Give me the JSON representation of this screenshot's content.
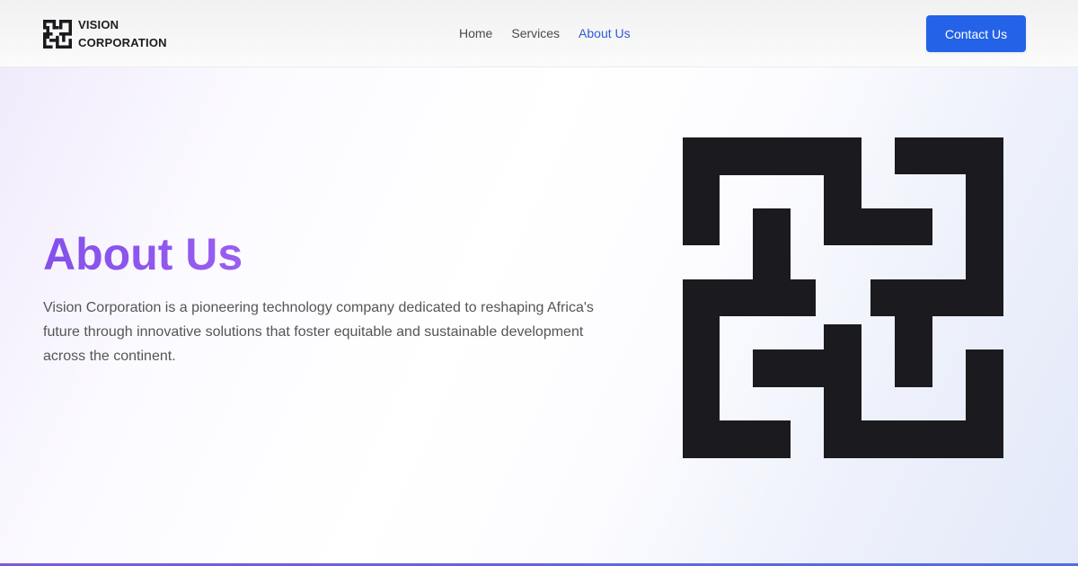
{
  "brand": {
    "name_line1": "VISION",
    "name_line2": "CORPORATION",
    "logo_icon": "maze-logo-icon"
  },
  "nav": {
    "items": [
      {
        "label": "Home",
        "active": false
      },
      {
        "label": "Services",
        "active": false
      },
      {
        "label": "About Us",
        "active": true
      }
    ],
    "cta_label": "Contact Us"
  },
  "hero": {
    "title": "About Us",
    "description": "Vision Corporation is a pioneering technology company dedicated to reshaping Africa's future through innovative solutions that foster equitable and sustainable development across the continent.",
    "image_icon": "maze-logo-icon"
  },
  "colors": {
    "accent": "#2462e8",
    "active_link": "#2f5cd8",
    "title_gradient_start": "#8450ea",
    "title_gradient_end": "#9a5df0",
    "logo": "#1b1b1f"
  }
}
